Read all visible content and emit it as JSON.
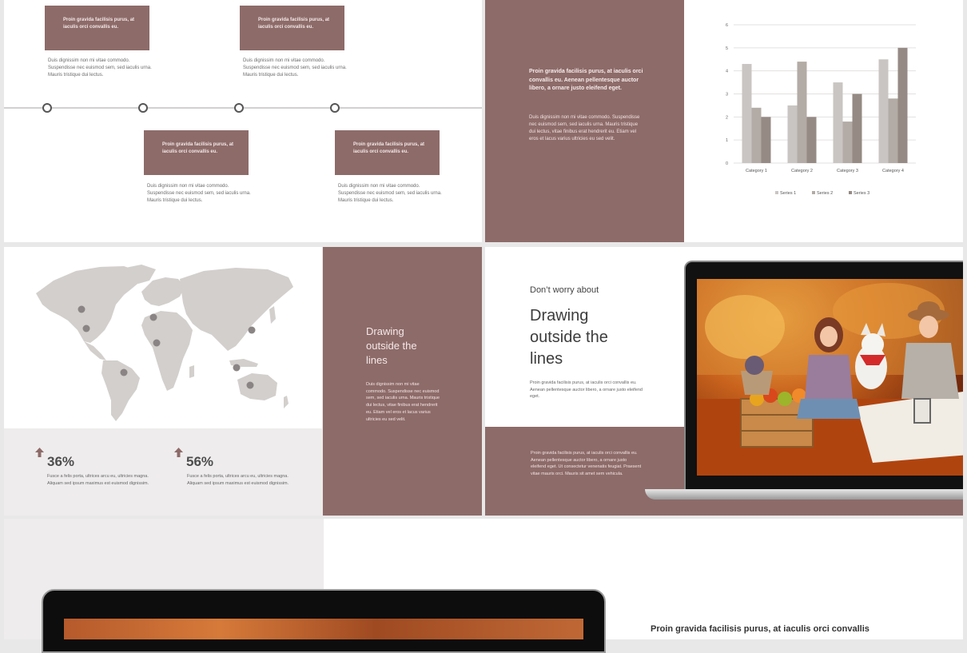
{
  "timeline": {
    "box_text": "Proin gravida facilisis purus, at iaculis orci convallis eu.",
    "body_line1": "Duis dignissim non mi vitae commodo.",
    "body_line2": "Suspendisse nec euismod sem, sed iaculis urna.",
    "body_line3": "Mauris tristique dui lectus."
  },
  "rose_slide": {
    "heading": "Proin gravida facilisis purus, at iaculis orci convallis eu. Aenean pellentesque auctor libero, a ornare justo eleifend eget.",
    "body": "Duis dignissim non mi vitae commodo. Suspendisse nec euismod sem, sed iaculis urna. Mauris tristique dui lectus, vitae finibus erat hendrerit eu. Etiam vel eros et lacus varius ultricies eu sed velit."
  },
  "chart_data": {
    "type": "bar",
    "categories": [
      "Category 1",
      "Category 2",
      "Category 3",
      "Category 4"
    ],
    "series": [
      {
        "name": "Series 1",
        "values": [
          4.3,
          2.5,
          3.5,
          4.5
        ]
      },
      {
        "name": "Series 2",
        "values": [
          2.4,
          4.4,
          1.8,
          2.8
        ]
      },
      {
        "name": "Series 3",
        "values": [
          2,
          2,
          3,
          5
        ]
      }
    ],
    "ylim": [
      0,
      6
    ],
    "yticks": [
      0,
      1,
      2,
      3,
      4,
      5,
      6
    ],
    "grid": true,
    "legend": "bottom",
    "colors": [
      "#c9c5c2",
      "#b3aba5",
      "#958a84"
    ]
  },
  "stats": [
    {
      "value": "36%",
      "line1": "Fusce a felis porta, ultrices arcu eu, ultricies magna.",
      "line2": "Aliquam sed ipsum maximus est euismod dignissim."
    },
    {
      "value": "56%",
      "line1": "Fusce a felis porta, ultrices arcu eu, ultricies magna.",
      "line2": "Aliquam sed ipsum maximus est euismod dignissim."
    }
  ],
  "drawing_rose": {
    "title_line1": "Drawing",
    "title_line2": "outside the",
    "title_line3": "lines",
    "body": "Duis dignissim non mi vitae commodo. Suspendisse nec euismod sem, sed iaculis urna. Mauris tristique dui lectus, vitae finibus erat hendrerit eu. Etiam vel eros et lacus varius ultricies eu sed velit."
  },
  "drawing_photo": {
    "kicker": "Don’t worry about",
    "title_line1": "Drawing",
    "title_line2": "outside the",
    "title_line3": "lines",
    "body": "Proin gravida facilisis purus, at iaculis orci convallis eu. Aenean pellentesque auctor libero, a ornare justo eleifend eget.",
    "rose_body": "Proin gravida facilisis purus, at iaculis orci convallis eu. Aenean pellentesque auctor libero, a ornare justo eleifend eget. Ut consectetur venenatis feugiat. Praesent vitae mauris orci. Mauris sit amet sem vehicula."
  },
  "bottom_slide": {
    "heading": "Proin gravida facilisis purus, at iaculis orci convallis"
  },
  "colors": {
    "rose": "#8d6b69",
    "map_land": "#d2cfcc",
    "pin": "#8a8584"
  }
}
